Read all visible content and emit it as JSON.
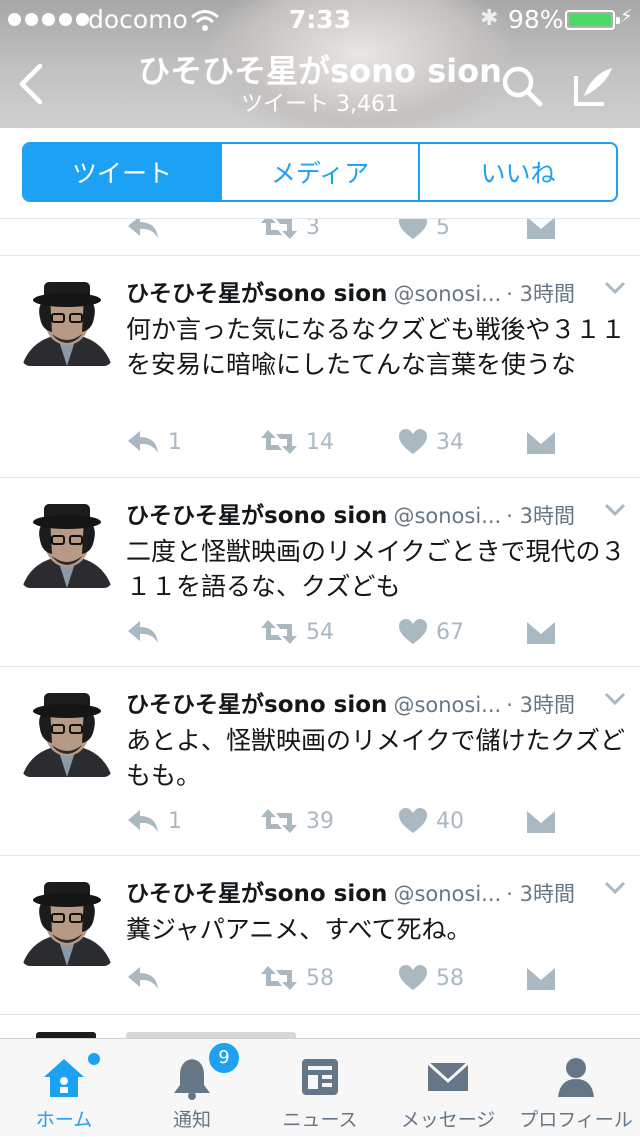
{
  "status_bar": {
    "carrier": "docomo",
    "time": "7:33",
    "battery_percent": "98%",
    "battery_level": 0.98,
    "signal_bars": 5
  },
  "nav": {
    "title": "ひそひそ星がsono sion",
    "subtitle": "ツイート 3,461"
  },
  "segments": [
    {
      "label": "ツイート",
      "active": true
    },
    {
      "label": "メディア",
      "active": false
    },
    {
      "label": "いいね",
      "active": false
    }
  ],
  "partial_top": {
    "retweets": "3",
    "likes": "5"
  },
  "tweets": [
    {
      "name": "ひそひそ星がsono sion",
      "handle": "@sonosi...",
      "time": "· 3時間",
      "text": "何か言った気になるなクズども戦後や３１１を安易に暗喩にしたてんな言葉を使うな",
      "replies": "1",
      "retweets": "14",
      "likes": "34"
    },
    {
      "name": "ひそひそ星がsono sion",
      "handle": "@sonosi...",
      "time": "· 3時間",
      "text": "二度と怪獣映画のリメイクごときで現代の３１１を語るな、クズども",
      "replies": "",
      "retweets": "54",
      "likes": "67"
    },
    {
      "name": "ひそひそ星がsono sion",
      "handle": "@sonosi...",
      "time": "· 3時間",
      "text": "あとよ、怪獣映画のリメイクで儲けたクズどもも。",
      "replies": "1",
      "retweets": "39",
      "likes": "40"
    },
    {
      "name": "ひそひそ星がsono sion",
      "handle": "@sonosi...",
      "time": "· 3時間",
      "text": "糞ジャパアニメ、すべて死ね。",
      "replies": "",
      "retweets": "58",
      "likes": "58"
    }
  ],
  "tabbar": [
    {
      "label": "ホーム",
      "icon": "home-icon",
      "active": true
    },
    {
      "label": "通知",
      "icon": "bell-icon",
      "badge": "9"
    },
    {
      "label": "ニュース",
      "icon": "news-icon"
    },
    {
      "label": "メッセージ",
      "icon": "envelope-icon"
    },
    {
      "label": "プロフィール",
      "icon": "person-icon"
    }
  ],
  "colors": {
    "accent": "#1da1f2",
    "muted_text": "#657786",
    "action_grey": "#aab8c2",
    "battery_green": "#4cd964"
  }
}
